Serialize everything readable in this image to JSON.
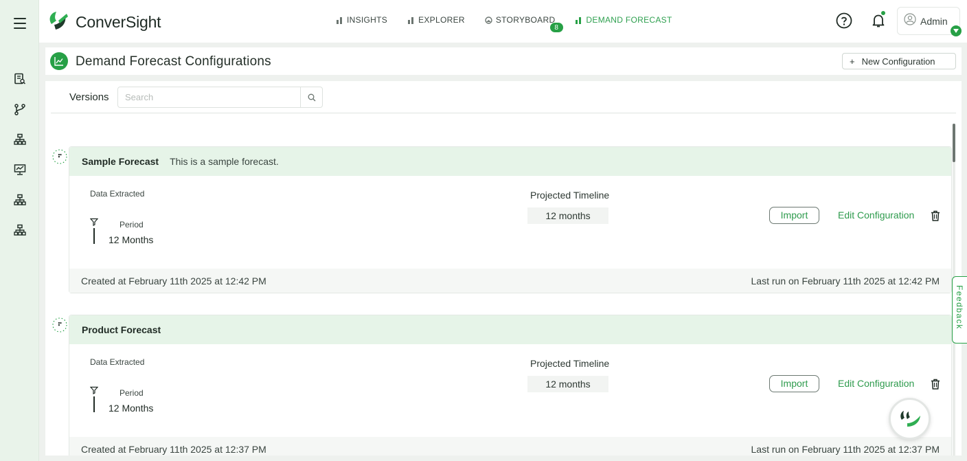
{
  "app": {
    "brand": "ConverSight",
    "accent_color": "#27a046"
  },
  "nav": {
    "items": [
      {
        "label": "INSIGHTS",
        "icon": "bar-chart-icon"
      },
      {
        "label": "EXPLORER",
        "icon": "bar-chart-icon"
      },
      {
        "label": "STORYBOARD",
        "icon": "storyboard-icon",
        "badge": "8"
      },
      {
        "label": "DEMAND FORECAST",
        "icon": "bar-chart-icon",
        "active": true
      }
    ]
  },
  "user": {
    "label": "Admin"
  },
  "sidebar": {
    "icons": [
      "menu-icon",
      "report-icon",
      "branch-icon",
      "hierarchy-icon",
      "presentation-icon",
      "hierarchy-icon",
      "hierarchy-icon"
    ]
  },
  "page": {
    "title": "Demand Forecast Configurations",
    "new_config_label": "New Configuration",
    "new_config_plus": "+"
  },
  "versions": {
    "label": "Versions",
    "search_placeholder": "Search"
  },
  "cards": [
    {
      "name": "Sample Forecast",
      "description": "This is a sample forecast.",
      "data_extracted_label": "Data Extracted",
      "period_label": "Period",
      "period_value": "12 Months",
      "projected_label": "Projected Timeline",
      "projected_value": "12 months",
      "import_label": "Import",
      "edit_label": "Edit Configuration",
      "created": "Created at February 11th 2025 at 12:42 PM",
      "last_run": "Last run on February 11th 2025 at 12:42 PM"
    },
    {
      "name": "Product Forecast",
      "description": "",
      "data_extracted_label": "Data Extracted",
      "period_label": "Period",
      "period_value": "12 Months",
      "projected_label": "Projected Timeline",
      "projected_value": "12 months",
      "import_label": "Import",
      "edit_label": "Edit Configuration",
      "created": "Created at February 11th 2025 at 12:37 PM",
      "last_run": "Last run on February 11th 2025 at 12:37 PM"
    }
  ],
  "feedback_label": "Feedback"
}
